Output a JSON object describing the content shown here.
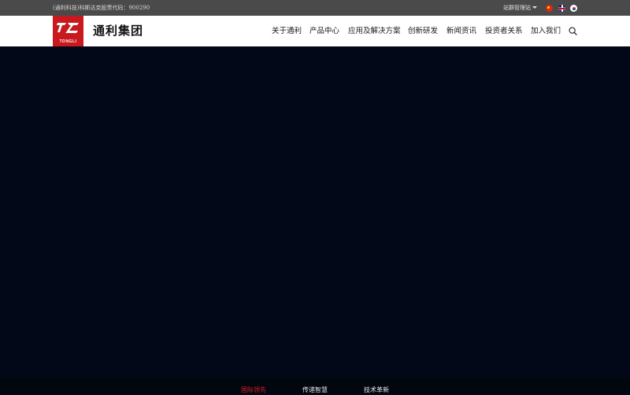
{
  "topbar": {
    "stock_text": "(通利科技)科斯达克股票代码：900290",
    "site_admin": "站群管理站",
    "languages": [
      "chinese-flag-icon",
      "uk-flag-icon",
      "korea-flag-icon"
    ]
  },
  "header": {
    "logo_text": "TONGLI",
    "brand_name": "通利集团",
    "nav": [
      {
        "label": "关于通利"
      },
      {
        "label": "产品中心"
      },
      {
        "label": "应用及解决方案"
      },
      {
        "label": "创新研发"
      },
      {
        "label": "新闻资讯"
      },
      {
        "label": "投资者关系"
      },
      {
        "label": "加入我们"
      }
    ],
    "search_icon": "search-icon"
  },
  "colors": {
    "brand_red": "#c8191f",
    "hero_bg": "#030818",
    "topbar_bg": "#4a4a4a",
    "active_tab": "#e02020"
  },
  "tabs": [
    {
      "label": "国际领先",
      "active": true
    },
    {
      "label": "传递智慧",
      "active": false
    },
    {
      "label": "技术革新",
      "active": false
    }
  ]
}
